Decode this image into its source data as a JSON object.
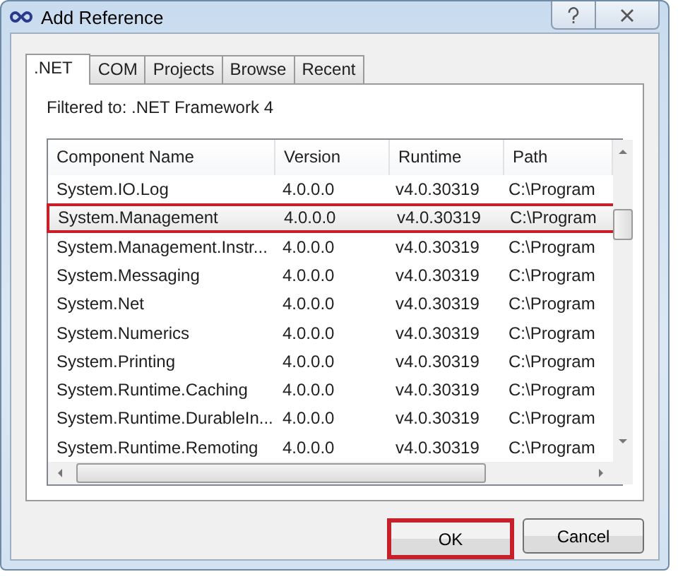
{
  "window": {
    "title": "Add Reference"
  },
  "tabs": [
    {
      "label": ".NET",
      "selected": true
    },
    {
      "label": "COM",
      "selected": false
    },
    {
      "label": "Projects",
      "selected": false
    },
    {
      "label": "Browse",
      "selected": false
    },
    {
      "label": "Recent",
      "selected": false
    }
  ],
  "filter_text": "Filtered to: .NET Framework 4",
  "table": {
    "columns": [
      "Component Name",
      "Version",
      "Runtime",
      "Path"
    ],
    "rows": [
      {
        "cells": [
          "System.IO.Log",
          "4.0.0.0",
          "v4.0.30319",
          "C:\\Program"
        ],
        "highlighted": false
      },
      {
        "cells": [
          "System.Management",
          "4.0.0.0",
          "v4.0.30319",
          "C:\\Program"
        ],
        "highlighted": true
      },
      {
        "cells": [
          "System.Management.Instr...",
          "4.0.0.0",
          "v4.0.30319",
          "C:\\Program"
        ],
        "highlighted": false
      },
      {
        "cells": [
          "System.Messaging",
          "4.0.0.0",
          "v4.0.30319",
          "C:\\Program"
        ],
        "highlighted": false
      },
      {
        "cells": [
          "System.Net",
          "4.0.0.0",
          "v4.0.30319",
          "C:\\Program"
        ],
        "highlighted": false
      },
      {
        "cells": [
          "System.Numerics",
          "4.0.0.0",
          "v4.0.30319",
          "C:\\Program"
        ],
        "highlighted": false
      },
      {
        "cells": [
          "System.Printing",
          "4.0.0.0",
          "v4.0.30319",
          "C:\\Program"
        ],
        "highlighted": false
      },
      {
        "cells": [
          "System.Runtime.Caching",
          "4.0.0.0",
          "v4.0.30319",
          "C:\\Program"
        ],
        "highlighted": false
      },
      {
        "cells": [
          "System.Runtime.DurableIn...",
          "4.0.0.0",
          "v4.0.30319",
          "C:\\Program"
        ],
        "highlighted": false
      },
      {
        "cells": [
          "System.Runtime.Remoting",
          "4.0.0.0",
          "v4.0.30319",
          "C:\\Program"
        ],
        "highlighted": false
      }
    ]
  },
  "buttons": [
    {
      "label": "OK",
      "highlighted": true
    },
    {
      "label": "Cancel",
      "highlighted": false
    }
  ]
}
